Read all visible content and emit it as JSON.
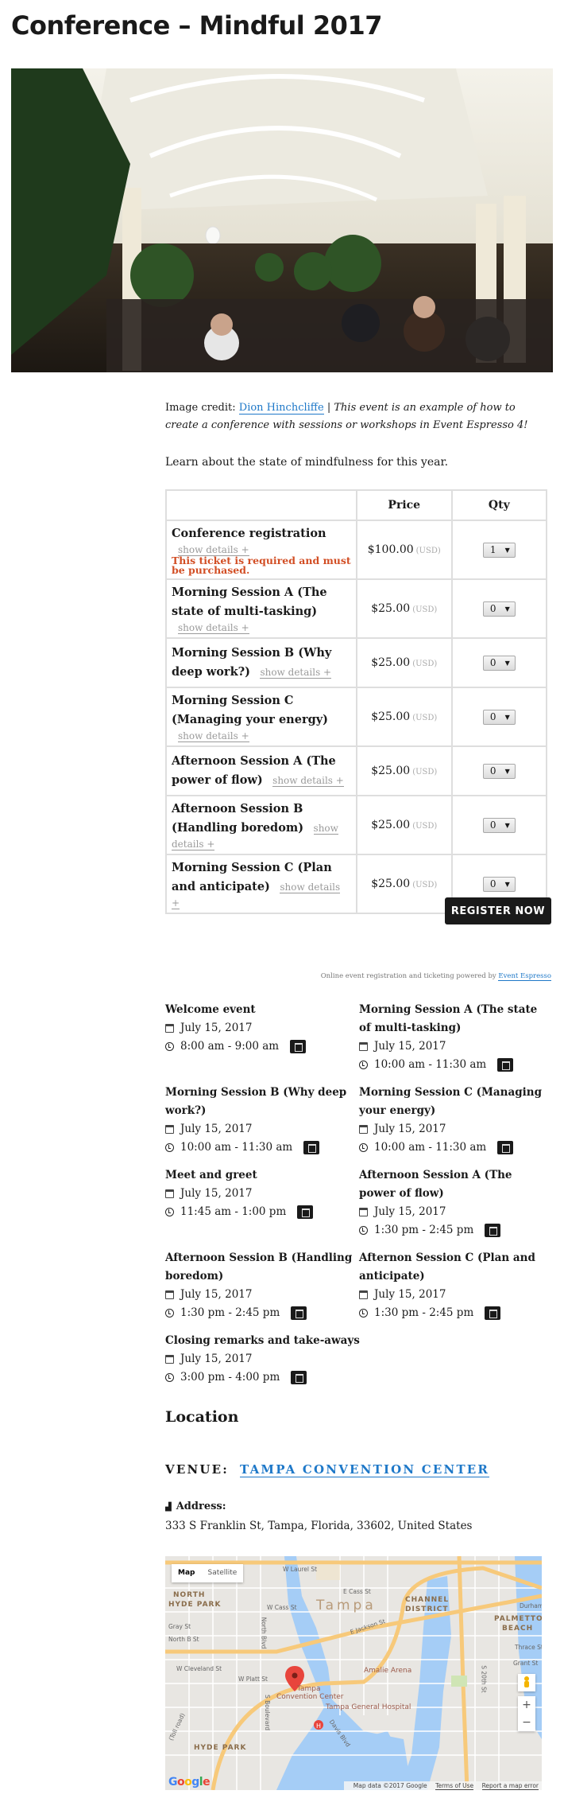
{
  "page": {
    "title": "Conference – Mindful 2017"
  },
  "hero": {
    "alt": "Conference hall with arched skylight ceiling and attendees"
  },
  "description": {
    "credit_prefix": "Image credit: ",
    "credit_link": "Dion Hinchcliffe",
    "credit_separator": " | ",
    "credit_note": "This event is an example of how to create a conference with sessions or workshops in Event Espresso 4!",
    "intro": "Learn about the state of mindfulness for this year."
  },
  "ticket_table": {
    "headers": {
      "name": "",
      "price": "Price",
      "qty": "Qty"
    },
    "show_details_label": "show details +",
    "currency_label": "(USD)",
    "tickets": [
      {
        "name": "Conference registration",
        "price": "$100.00",
        "qty": "1",
        "required_message": "This ticket is required and must be purchased."
      },
      {
        "name": "Morning Session A (The state of multi-tasking)",
        "price": "$25.00",
        "qty": "0"
      },
      {
        "name": "Morning Session B (Why deep work?)",
        "price": "$25.00",
        "qty": "0"
      },
      {
        "name": "Morning Session C (Managing your energy)",
        "price": "$25.00",
        "qty": "0"
      },
      {
        "name": "Afternoon Session A (The power of flow)",
        "price": "$25.00",
        "qty": "0"
      },
      {
        "name": "Afternoon Session B (Handling boredom)",
        "price": "$25.00",
        "qty": "0"
      },
      {
        "name": "Morning Session C (Plan and anticipate)",
        "price": "$25.00",
        "qty": "0"
      }
    ],
    "register_button": "REGISTER NOW"
  },
  "powered_by": {
    "text": "Online event registration and ticketing powered by ",
    "link": "Event Espresso"
  },
  "datetimes": [
    {
      "title": "Welcome event",
      "date": "July 15, 2017",
      "time": "8:00 am - 9:00 am"
    },
    {
      "title": "Morning Session A (The state of multi-tasking)",
      "date": "July 15, 2017",
      "time": "10:00 am - 11:30 am"
    },
    {
      "title": "Morning Session B (Why deep work?)",
      "date": "July 15, 2017",
      "time": "10:00 am - 11:30 am"
    },
    {
      "title": "Morning Session C (Managing your energy)",
      "date": "July 15, 2017",
      "time": "10:00 am - 11:30 am"
    },
    {
      "title": "Meet and greet",
      "date": "July 15, 2017",
      "time": "11:45 am - 1:00 pm"
    },
    {
      "title": "Afternoon Session A (The power of flow)",
      "date": "July 15, 2017",
      "time": "1:30 pm - 2:45 pm"
    },
    {
      "title": "Afternoon Session B (Handling boredom)",
      "date": "July 15, 2017",
      "time": "1:30 pm - 2:45 pm"
    },
    {
      "title": "Afternon Session C (Plan and anticipate)",
      "date": "July 15, 2017",
      "time": "1:30 pm - 2:45 pm"
    },
    {
      "title": "Closing remarks and take-aways",
      "date": "July 15, 2017",
      "time": "3:00 pm - 4:00 pm"
    }
  ],
  "location": {
    "heading": "Location",
    "venue_label": "VENUE:",
    "venue_name": "TAMPA CONVENTION CENTER",
    "address_label": "Address:",
    "address": "333 S Franklin St, Tampa, Florida, 33602, United States"
  },
  "map": {
    "type_map": "Map",
    "type_satellite": "Satellite",
    "zoom_in": "+",
    "zoom_out": "−",
    "attribution": "Map data ©2017 Google",
    "terms": "Terms of Use",
    "report": "Report a map error",
    "logo": "Google",
    "labels": {
      "north_hyde_park_1": "NORTH",
      "north_hyde_park_2": "HYDE PARK",
      "tampa": "Tampa",
      "channel_1": "CHANNEL",
      "channel_2": "DISTRICT",
      "palmetto_1": "PALMETTO",
      "palmetto_2": "BEACH",
      "hyde_park": "HYDE PARK",
      "w_laurel": "W Laurel St",
      "w_cass": "W Cass St",
      "e_cass": "E Cass St",
      "gray_st": "Gray St",
      "north_b": "North B St",
      "north_blvd": "North Blvd",
      "w_cleveland": "W Cleveland St",
      "w_platt": "W Platt St",
      "e_jackson": "E Jackson St",
      "amalie": "Amalie Arena",
      "convention_1": "Tampa",
      "convention_2": "Convention Center",
      "hospital": "Tampa General Hospital",
      "durham": "Durham",
      "thrace": "Thrace St",
      "grant": "Grant St",
      "s_20th": "S 20th St",
      "s_boulevard": "S Boulevard",
      "davis": "Davis Blvd",
      "toll": "(Toll road)"
    }
  },
  "colors": {
    "link": "#1e78c8",
    "required": "#d24e24",
    "button_bg": "#1a1a1a"
  }
}
